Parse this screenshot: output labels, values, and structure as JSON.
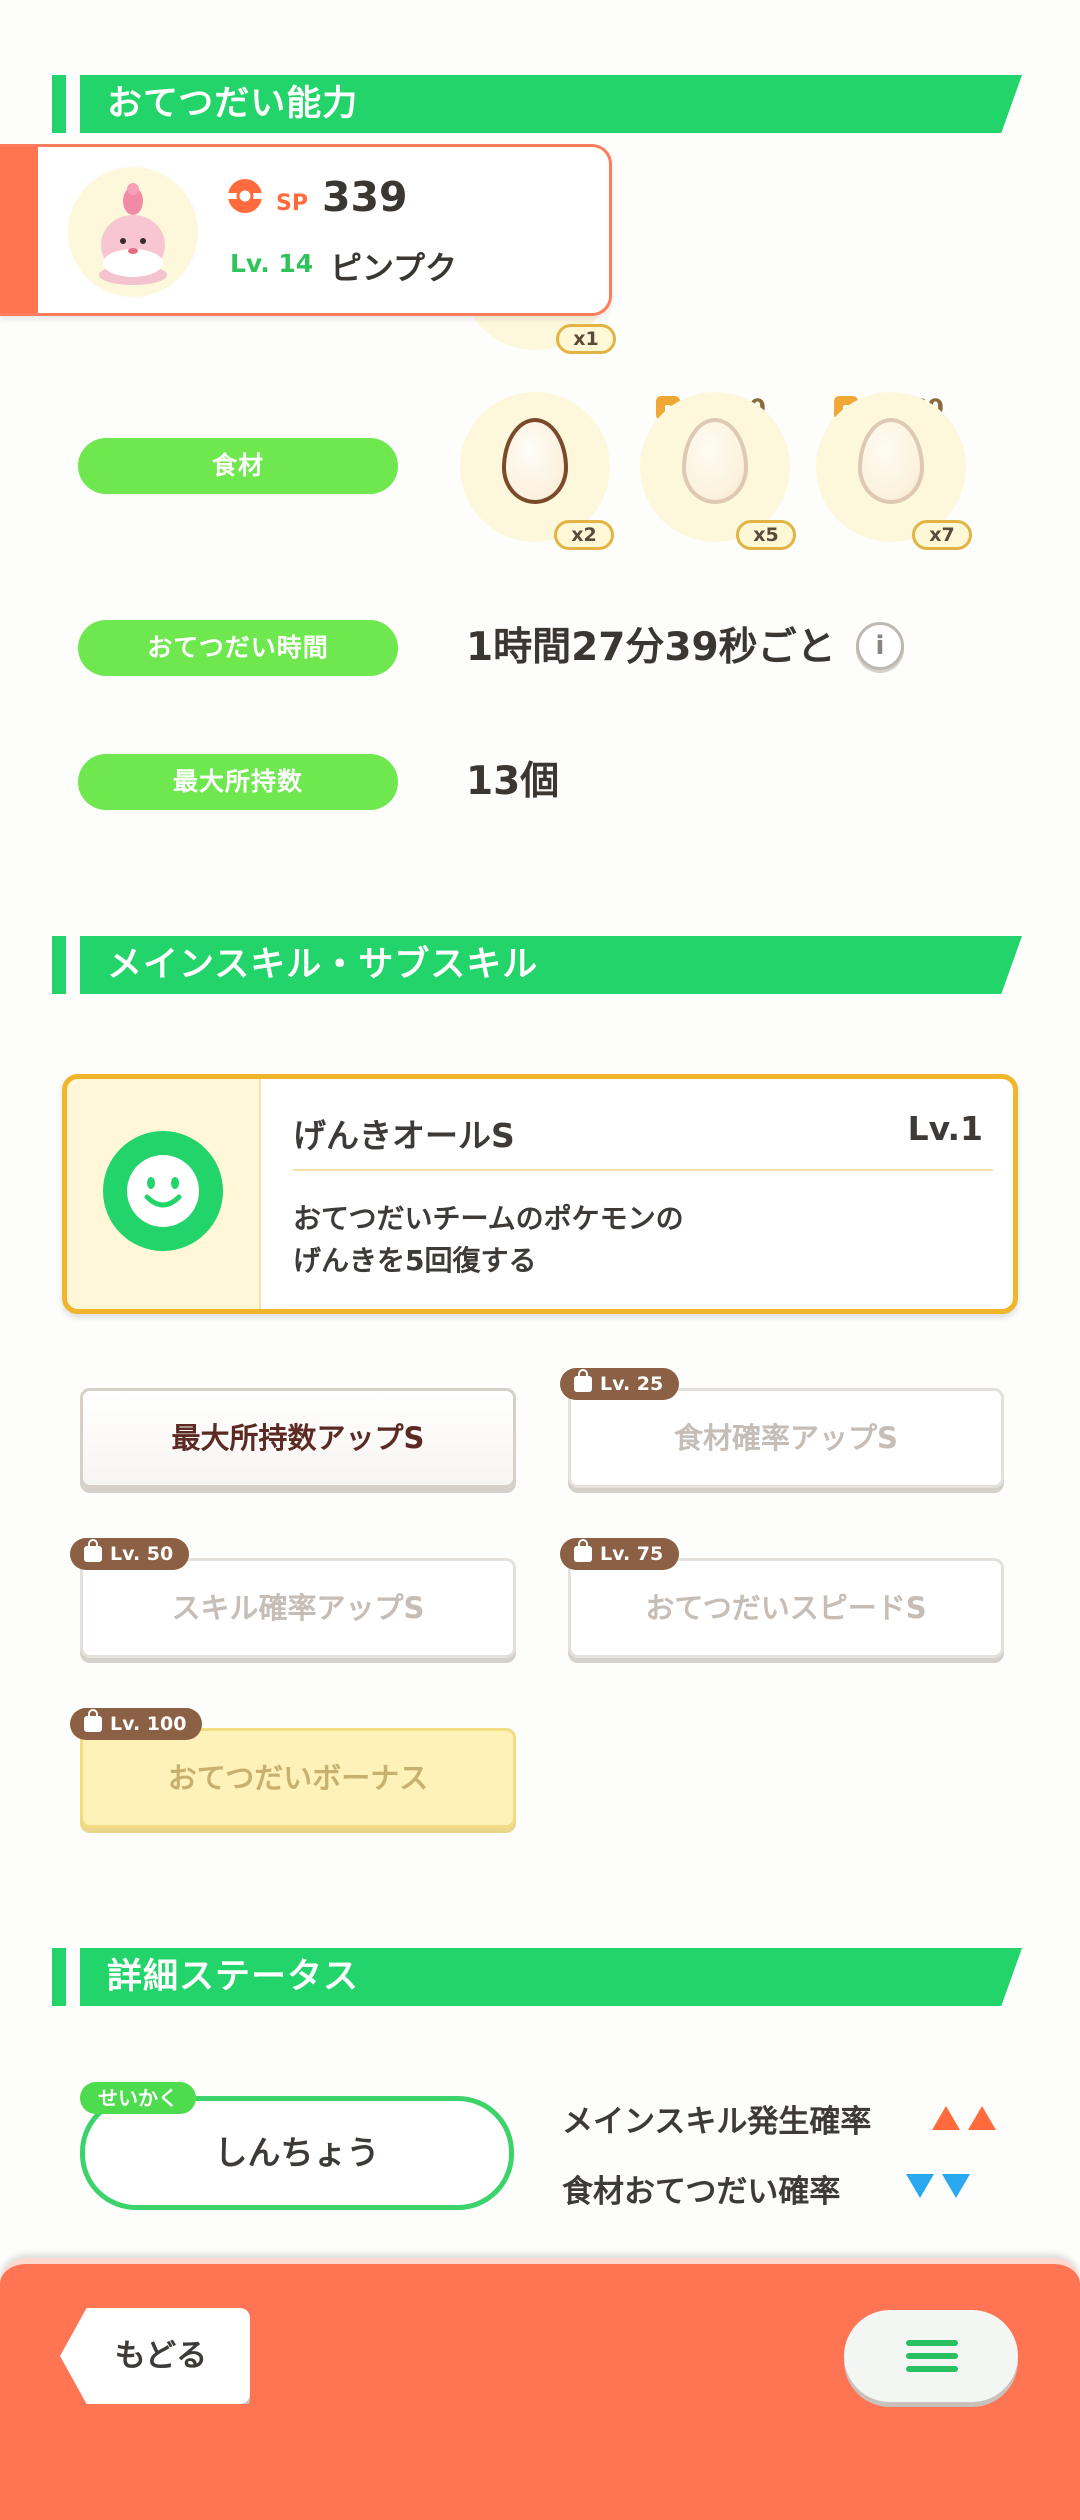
{
  "sections": {
    "helping_ability": "おてつだい能力",
    "skills": "メインスキル・サブスキル",
    "detail_status": "詳細ステータス"
  },
  "pokemon": {
    "sp_label": "SP",
    "sp_value": "339",
    "level": "Lv. 14",
    "name": "ピンプク",
    "hidden_qty": "x1"
  },
  "ingredients": {
    "label": "食材",
    "items": [
      {
        "qty": "x2",
        "lock": ""
      },
      {
        "qty": "x5",
        "lock": "Lv. 30"
      },
      {
        "qty": "x7",
        "lock": "Lv. 60"
      }
    ]
  },
  "help_time": {
    "label": "おてつだい時間",
    "value": "1時間27分39秒ごと"
  },
  "max_carry": {
    "label": "最大所持数",
    "value": "13個"
  },
  "main_skill": {
    "name": "げんきオールS",
    "level": "Lv.1",
    "desc_line1": "おてつだいチームのポケモンの",
    "desc_line2": "げんきを5回復する"
  },
  "sub_skills": [
    {
      "label": "最大所持数アップS",
      "lock": ""
    },
    {
      "label": "食材確率アップS",
      "lock": "Lv. 25"
    },
    {
      "label": "スキル確率アップS",
      "lock": "Lv. 50"
    },
    {
      "label": "おてつだいスピードS",
      "lock": "Lv. 75"
    },
    {
      "label": "おてつだいボーナス",
      "lock": "Lv. 100"
    }
  ],
  "nature": {
    "tag": "せいかく",
    "value": "しんちょう",
    "up": "メインスキル発生確率",
    "down": "食材おてつだい確率"
  },
  "footer": {
    "back": "もどる"
  },
  "colors": {
    "green": "#22d46a",
    "pill_green": "#6ee84e",
    "orange": "#ff7452",
    "up_arrow": "#ff6b3d",
    "down_arrow": "#2aa8f0"
  }
}
